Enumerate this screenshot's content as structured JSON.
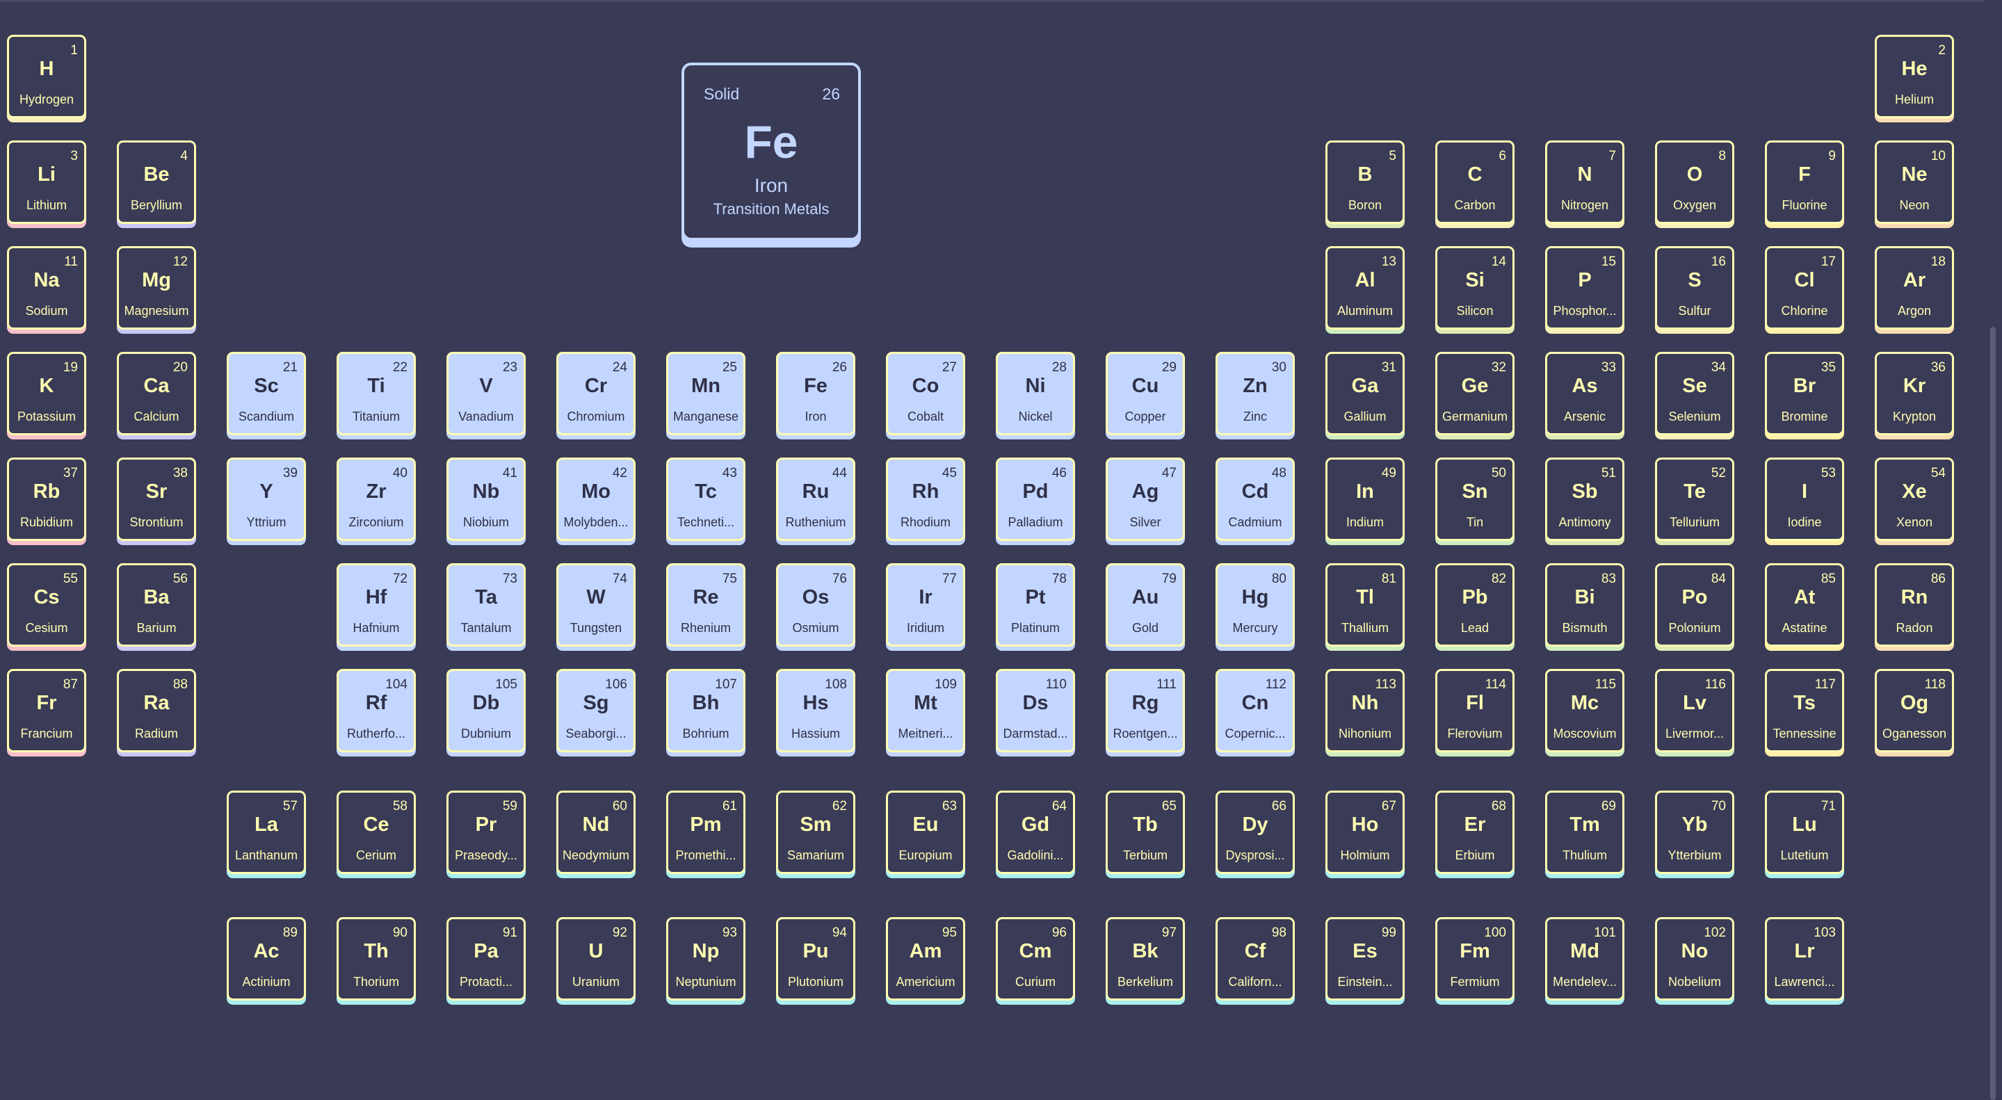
{
  "colors": {
    "background": "#393a56",
    "alkali": "#f8c0c8",
    "alkaline": "#c8c8f6",
    "transition": "#c3d6ff",
    "metal": "#cfeec0",
    "metalloid": "#ddeab4",
    "nonmetal": "#f8f0b8",
    "halogen": "#fff0a8",
    "noble": "#f8dcb4",
    "lanthanide": "#a8f0f0",
    "actinide": "#a8f0ee"
  },
  "details": {
    "state": "Solid",
    "number": "26",
    "symbol": "Fe",
    "name": "Iron",
    "category": "Transition Metals"
  },
  "elements": [
    {
      "n": "1",
      "s": "H",
      "name": "Hydrogen",
      "c": "nonmetal"
    },
    {
      "n": "2",
      "s": "He",
      "name": "Helium",
      "c": "noble"
    },
    {
      "n": "3",
      "s": "Li",
      "name": "Lithium",
      "c": "alkali"
    },
    {
      "n": "4",
      "s": "Be",
      "name": "Beryllium",
      "c": "alkaline"
    },
    {
      "n": "5",
      "s": "B",
      "name": "Boron",
      "c": "metalloid"
    },
    {
      "n": "6",
      "s": "C",
      "name": "Carbon",
      "c": "nonmetal"
    },
    {
      "n": "7",
      "s": "N",
      "name": "Nitrogen",
      "c": "nonmetal"
    },
    {
      "n": "8",
      "s": "O",
      "name": "Oxygen",
      "c": "nonmetal"
    },
    {
      "n": "9",
      "s": "F",
      "name": "Fluorine",
      "c": "halogen"
    },
    {
      "n": "10",
      "s": "Ne",
      "name": "Neon",
      "c": "noble"
    },
    {
      "n": "11",
      "s": "Na",
      "name": "Sodium",
      "c": "alkali"
    },
    {
      "n": "12",
      "s": "Mg",
      "name": "Magnesium",
      "c": "alkaline"
    },
    {
      "n": "13",
      "s": "Al",
      "name": "Aluminum",
      "c": "metal"
    },
    {
      "n": "14",
      "s": "Si",
      "name": "Silicon",
      "c": "metalloid"
    },
    {
      "n": "15",
      "s": "P",
      "name": "Phosphor...",
      "c": "nonmetal"
    },
    {
      "n": "16",
      "s": "S",
      "name": "Sulfur",
      "c": "nonmetal"
    },
    {
      "n": "17",
      "s": "Cl",
      "name": "Chlorine",
      "c": "halogen"
    },
    {
      "n": "18",
      "s": "Ar",
      "name": "Argon",
      "c": "noble"
    },
    {
      "n": "19",
      "s": "K",
      "name": "Potassium",
      "c": "alkali"
    },
    {
      "n": "20",
      "s": "Ca",
      "name": "Calcium",
      "c": "alkaline"
    },
    {
      "n": "21",
      "s": "Sc",
      "name": "Scandium",
      "c": "transition"
    },
    {
      "n": "22",
      "s": "Ti",
      "name": "Titanium",
      "c": "transition"
    },
    {
      "n": "23",
      "s": "V",
      "name": "Vanadium",
      "c": "transition"
    },
    {
      "n": "24",
      "s": "Cr",
      "name": "Chromium",
      "c": "transition"
    },
    {
      "n": "25",
      "s": "Mn",
      "name": "Manganese",
      "c": "transition"
    },
    {
      "n": "26",
      "s": "Fe",
      "name": "Iron",
      "c": "transition"
    },
    {
      "n": "27",
      "s": "Co",
      "name": "Cobalt",
      "c": "transition"
    },
    {
      "n": "28",
      "s": "Ni",
      "name": "Nickel",
      "c": "transition"
    },
    {
      "n": "29",
      "s": "Cu",
      "name": "Copper",
      "c": "transition"
    },
    {
      "n": "30",
      "s": "Zn",
      "name": "Zinc",
      "c": "transition"
    },
    {
      "n": "31",
      "s": "Ga",
      "name": "Gallium",
      "c": "metal"
    },
    {
      "n": "32",
      "s": "Ge",
      "name": "Germanium",
      "c": "metalloid"
    },
    {
      "n": "33",
      "s": "As",
      "name": "Arsenic",
      "c": "metalloid"
    },
    {
      "n": "34",
      "s": "Se",
      "name": "Selenium",
      "c": "nonmetal"
    },
    {
      "n": "35",
      "s": "Br",
      "name": "Bromine",
      "c": "halogen"
    },
    {
      "n": "36",
      "s": "Kr",
      "name": "Krypton",
      "c": "noble"
    },
    {
      "n": "37",
      "s": "Rb",
      "name": "Rubidium",
      "c": "alkali"
    },
    {
      "n": "38",
      "s": "Sr",
      "name": "Strontium",
      "c": "alkaline"
    },
    {
      "n": "39",
      "s": "Y",
      "name": "Yttrium",
      "c": "transition"
    },
    {
      "n": "40",
      "s": "Zr",
      "name": "Zirconium",
      "c": "transition"
    },
    {
      "n": "41",
      "s": "Nb",
      "name": "Niobium",
      "c": "transition"
    },
    {
      "n": "42",
      "s": "Mo",
      "name": "Molybden...",
      "c": "transition"
    },
    {
      "n": "43",
      "s": "Tc",
      "name": "Techneti...",
      "c": "transition"
    },
    {
      "n": "44",
      "s": "Ru",
      "name": "Ruthenium",
      "c": "transition"
    },
    {
      "n": "45",
      "s": "Rh",
      "name": "Rhodium",
      "c": "transition"
    },
    {
      "n": "46",
      "s": "Pd",
      "name": "Palladium",
      "c": "transition"
    },
    {
      "n": "47",
      "s": "Ag",
      "name": "Silver",
      "c": "transition"
    },
    {
      "n": "48",
      "s": "Cd",
      "name": "Cadmium",
      "c": "transition"
    },
    {
      "n": "49",
      "s": "In",
      "name": "Indium",
      "c": "metal"
    },
    {
      "n": "50",
      "s": "Sn",
      "name": "Tin",
      "c": "metal"
    },
    {
      "n": "51",
      "s": "Sb",
      "name": "Antimony",
      "c": "metalloid"
    },
    {
      "n": "52",
      "s": "Te",
      "name": "Tellurium",
      "c": "metalloid"
    },
    {
      "n": "53",
      "s": "I",
      "name": "Iodine",
      "c": "halogen"
    },
    {
      "n": "54",
      "s": "Xe",
      "name": "Xenon",
      "c": "noble"
    },
    {
      "n": "55",
      "s": "Cs",
      "name": "Cesium",
      "c": "alkali"
    },
    {
      "n": "56",
      "s": "Ba",
      "name": "Barium",
      "c": "alkaline"
    },
    {
      "n": "72",
      "s": "Hf",
      "name": "Hafnium",
      "c": "transition"
    },
    {
      "n": "73",
      "s": "Ta",
      "name": "Tantalum",
      "c": "transition"
    },
    {
      "n": "74",
      "s": "W",
      "name": "Tungsten",
      "c": "transition"
    },
    {
      "n": "75",
      "s": "Re",
      "name": "Rhenium",
      "c": "transition"
    },
    {
      "n": "76",
      "s": "Os",
      "name": "Osmium",
      "c": "transition"
    },
    {
      "n": "77",
      "s": "Ir",
      "name": "Iridium",
      "c": "transition"
    },
    {
      "n": "78",
      "s": "Pt",
      "name": "Platinum",
      "c": "transition"
    },
    {
      "n": "79",
      "s": "Au",
      "name": "Gold",
      "c": "transition"
    },
    {
      "n": "80",
      "s": "Hg",
      "name": "Mercury",
      "c": "transition"
    },
    {
      "n": "81",
      "s": "Tl",
      "name": "Thallium",
      "c": "metal"
    },
    {
      "n": "82",
      "s": "Pb",
      "name": "Lead",
      "c": "metal"
    },
    {
      "n": "83",
      "s": "Bi",
      "name": "Bismuth",
      "c": "metal"
    },
    {
      "n": "84",
      "s": "Po",
      "name": "Polonium",
      "c": "metalloid"
    },
    {
      "n": "85",
      "s": "At",
      "name": "Astatine",
      "c": "halogen"
    },
    {
      "n": "86",
      "s": "Rn",
      "name": "Radon",
      "c": "noble"
    },
    {
      "n": "87",
      "s": "Fr",
      "name": "Francium",
      "c": "alkali"
    },
    {
      "n": "88",
      "s": "Ra",
      "name": "Radium",
      "c": "alkaline"
    },
    {
      "n": "104",
      "s": "Rf",
      "name": "Rutherfo...",
      "c": "transition"
    },
    {
      "n": "105",
      "s": "Db",
      "name": "Dubnium",
      "c": "transition"
    },
    {
      "n": "106",
      "s": "Sg",
      "name": "Seaborgi...",
      "c": "transition"
    },
    {
      "n": "107",
      "s": "Bh",
      "name": "Bohrium",
      "c": "transition"
    },
    {
      "n": "108",
      "s": "Hs",
      "name": "Hassium",
      "c": "transition"
    },
    {
      "n": "109",
      "s": "Mt",
      "name": "Meitneri...",
      "c": "transition"
    },
    {
      "n": "110",
      "s": "Ds",
      "name": "Darmstad...",
      "c": "transition"
    },
    {
      "n": "111",
      "s": "Rg",
      "name": "Roentgen...",
      "c": "transition"
    },
    {
      "n": "112",
      "s": "Cn",
      "name": "Copernic...",
      "c": "transition"
    },
    {
      "n": "113",
      "s": "Nh",
      "name": "Nihonium",
      "c": "metal"
    },
    {
      "n": "114",
      "s": "Fl",
      "name": "Flerovium",
      "c": "metal"
    },
    {
      "n": "115",
      "s": "Mc",
      "name": "Moscovium",
      "c": "metal"
    },
    {
      "n": "116",
      "s": "Lv",
      "name": "Livermor...",
      "c": "metal"
    },
    {
      "n": "117",
      "s": "Ts",
      "name": "Tennessine",
      "c": "halogen"
    },
    {
      "n": "118",
      "s": "Og",
      "name": "Oganesson",
      "c": "noble"
    },
    {
      "n": "57",
      "s": "La",
      "name": "Lanthanum",
      "c": "lanthanide"
    },
    {
      "n": "58",
      "s": "Ce",
      "name": "Cerium",
      "c": "lanthanide"
    },
    {
      "n": "59",
      "s": "Pr",
      "name": "Praseody...",
      "c": "lanthanide"
    },
    {
      "n": "60",
      "s": "Nd",
      "name": "Neodymium",
      "c": "lanthanide"
    },
    {
      "n": "61",
      "s": "Pm",
      "name": "Promethi...",
      "c": "lanthanide"
    },
    {
      "n": "62",
      "s": "Sm",
      "name": "Samarium",
      "c": "lanthanide"
    },
    {
      "n": "63",
      "s": "Eu",
      "name": "Europium",
      "c": "lanthanide"
    },
    {
      "n": "64",
      "s": "Gd",
      "name": "Gadolini...",
      "c": "lanthanide"
    },
    {
      "n": "65",
      "s": "Tb",
      "name": "Terbium",
      "c": "lanthanide"
    },
    {
      "n": "66",
      "s": "Dy",
      "name": "Dysprosi...",
      "c": "lanthanide"
    },
    {
      "n": "67",
      "s": "Ho",
      "name": "Holmium",
      "c": "lanthanide"
    },
    {
      "n": "68",
      "s": "Er",
      "name": "Erbium",
      "c": "lanthanide"
    },
    {
      "n": "69",
      "s": "Tm",
      "name": "Thulium",
      "c": "lanthanide"
    },
    {
      "n": "70",
      "s": "Yb",
      "name": "Ytterbium",
      "c": "lanthanide"
    },
    {
      "n": "71",
      "s": "Lu",
      "name": "Lutetium",
      "c": "lanthanide"
    },
    {
      "n": "89",
      "s": "Ac",
      "name": "Actinium",
      "c": "actinide"
    },
    {
      "n": "90",
      "s": "Th",
      "name": "Thorium",
      "c": "actinide"
    },
    {
      "n": "91",
      "s": "Pa",
      "name": "Protacti...",
      "c": "actinide"
    },
    {
      "n": "92",
      "s": "U",
      "name": "Uranium",
      "c": "actinide"
    },
    {
      "n": "93",
      "s": "Np",
      "name": "Neptunium",
      "c": "actinide"
    },
    {
      "n": "94",
      "s": "Pu",
      "name": "Plutonium",
      "c": "actinide"
    },
    {
      "n": "95",
      "s": "Am",
      "name": "Americium",
      "c": "actinide"
    },
    {
      "n": "96",
      "s": "Cm",
      "name": "Curium",
      "c": "actinide"
    },
    {
      "n": "97",
      "s": "Bk",
      "name": "Berkelium",
      "c": "actinide"
    },
    {
      "n": "98",
      "s": "Cf",
      "name": "Californ...",
      "c": "actinide"
    },
    {
      "n": "99",
      "s": "Es",
      "name": "Einstein...",
      "c": "actinide"
    },
    {
      "n": "100",
      "s": "Fm",
      "name": "Fermium",
      "c": "actinide"
    },
    {
      "n": "101",
      "s": "Md",
      "name": "Mendelev...",
      "c": "actinide"
    },
    {
      "n": "102",
      "s": "No",
      "name": "Nobelium",
      "c": "actinide"
    },
    {
      "n": "103",
      "s": "Lr",
      "name": "Lawrenci...",
      "c": "actinide"
    }
  ]
}
